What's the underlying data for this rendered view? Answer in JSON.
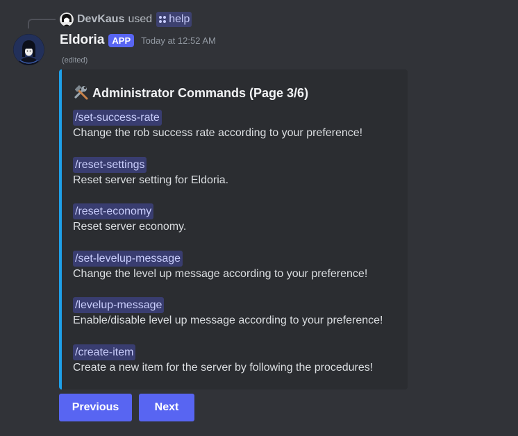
{
  "reply": {
    "username": "DevKaus",
    "used_text": "used",
    "command": "help"
  },
  "message": {
    "author": "Eldoria",
    "app_badge": "APP",
    "timestamp": "Today at 12:52 AM",
    "edited": "(edited)"
  },
  "embed": {
    "accent_color": "#1ea0e8",
    "title": "Administrator Commands (Page 3/6)",
    "title_icon": "hammer-wrench-icon",
    "commands": [
      {
        "command": "/set-success-rate",
        "description": "Change the rob success rate according to your preference!"
      },
      {
        "command": "/reset-settings",
        "description": "Reset server setting for Eldoria."
      },
      {
        "command": "/reset-economy",
        "description": "Reset server economy."
      },
      {
        "command": "/set-levelup-message",
        "description": "Change the level up message according to your preference!"
      },
      {
        "command": "/levelup-message",
        "description": "Enable/disable level up message according to your preference!"
      },
      {
        "command": "/create-item",
        "description": "Create a new item for the server by following the procedures!"
      }
    ]
  },
  "buttons": {
    "previous_label": "Previous",
    "next_label": "Next",
    "color": "#5865f2"
  }
}
